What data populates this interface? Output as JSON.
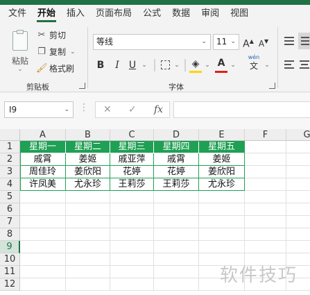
{
  "ribbon_tabs": [
    "文件",
    "开始",
    "插入",
    "页面布局",
    "公式",
    "数据",
    "审阅",
    "视图"
  ],
  "active_tab": "开始",
  "clipboard": {
    "paste_label": "粘贴",
    "cut_label": "剪切",
    "copy_label": "复制",
    "format_painter_label": "格式刷",
    "group_label": "剪贴板"
  },
  "font": {
    "name": "等线",
    "size": "11",
    "group_label": "字体",
    "bold": "B",
    "italic": "I",
    "underline": "U",
    "grow": "A",
    "shrink": "A",
    "phonetic_top": "wén",
    "phonetic_bottom": "文"
  },
  "colors": {
    "accent": "#207245",
    "header_fill": "#1fa055",
    "highlight": "#ffd400",
    "font_color": "#e0201b"
  },
  "formula_bar": {
    "name_box": "I9",
    "cancel": "✕",
    "enter": "✓",
    "fx": "fx",
    "value": ""
  },
  "columns": [
    "A",
    "B",
    "C",
    "D",
    "E",
    "F",
    "G"
  ],
  "rows": [
    "1",
    "2",
    "3",
    "4",
    "5",
    "6",
    "7",
    "8",
    "9",
    "10",
    "11",
    "12"
  ],
  "selected_row": "9",
  "table": {
    "header": [
      "星期一",
      "星期二",
      "星期三",
      "星期四",
      "星期五"
    ],
    "body": [
      [
        "戚霄",
        "姜姬",
        "戚亚萍",
        "戚霄",
        "姜姬"
      ],
      [
        "周佳玲",
        "姜欣阳",
        "花婷",
        "花婷",
        "姜欣阳"
      ],
      [
        "许凤美",
        "尤永珍",
        "王莉莎",
        "王莉莎",
        "尤永珍"
      ]
    ]
  },
  "watermark": "软件技巧"
}
